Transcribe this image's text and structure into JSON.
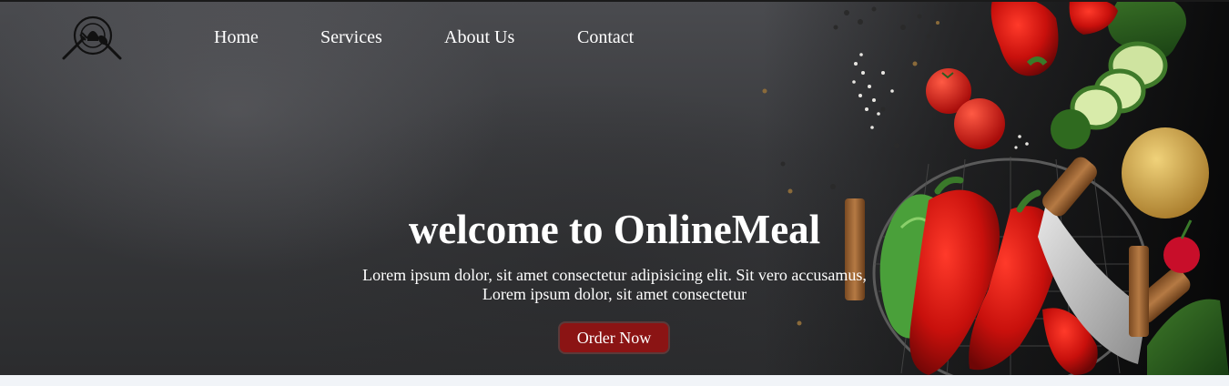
{
  "nav": {
    "items": [
      {
        "label": "Home"
      },
      {
        "label": "Services"
      },
      {
        "label": "About Us"
      },
      {
        "label": "Contact"
      }
    ]
  },
  "hero": {
    "title": "welcome to OnlineMeal",
    "subtitle_line1": "Lorem ipsum dolor, sit amet consectetur adipisicing elit. Sit vero accusamus,",
    "subtitle_line2": "Lorem ipsum dolor, sit amet consectetur",
    "cta_label": "Order Now",
    "background_image": "dark slate texture with vegetables (peppers, tomatoes, zucchini, potato, lettuce, mezzaluna knife in wire basket)"
  },
  "icons": {
    "logo": "plate-fork-spoon-logo-icon"
  },
  "colors": {
    "cta_background": "#8b1414",
    "text": "#ffffff",
    "hero_dark": "#2b2c2e",
    "page_background": "#f1f4f8"
  }
}
